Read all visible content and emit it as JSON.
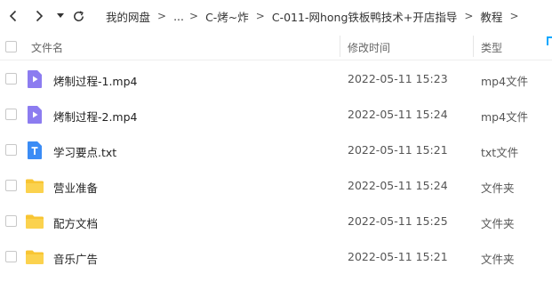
{
  "toolbar": {
    "back_icon": "chevron-left-icon",
    "forward_icon": "chevron-right-icon",
    "history_icon": "caret-down-icon",
    "refresh_icon": "refresh-icon"
  },
  "breadcrumb": [
    "我的网盘",
    "...",
    "C-烤~炸",
    "C-011-网hong铁板鸭技术+开店指导",
    "教程"
  ],
  "breadcrumb_separator": ">",
  "columns": {
    "name": "文件名",
    "modified": "修改时间",
    "type": "类型"
  },
  "files": [
    {
      "name": "烤制过程-1.mp4",
      "modified": "2022-05-11 15:23",
      "type": "mp4文件",
      "icon": "video-file-icon"
    },
    {
      "name": "烤制过程-2.mp4",
      "modified": "2022-05-11 15:24",
      "type": "mp4文件",
      "icon": "video-file-icon"
    },
    {
      "name": "学习要点.txt",
      "modified": "2022-05-11 15:21",
      "type": "txt文件",
      "icon": "text-file-icon"
    },
    {
      "name": "营业准备",
      "modified": "2022-05-11 15:24",
      "type": "文件夹",
      "icon": "folder-icon"
    },
    {
      "name": "配方文档",
      "modified": "2022-05-11 15:25",
      "type": "文件夹",
      "icon": "folder-icon"
    },
    {
      "name": "音乐广告",
      "modified": "2022-05-11 15:21",
      "type": "文件夹",
      "icon": "folder-icon"
    }
  ],
  "colors": {
    "video_icon": "#8c7cf0",
    "text_icon": "#3b8cf5",
    "folder_icon": "#f8c533",
    "accent": "#06a7ff"
  }
}
